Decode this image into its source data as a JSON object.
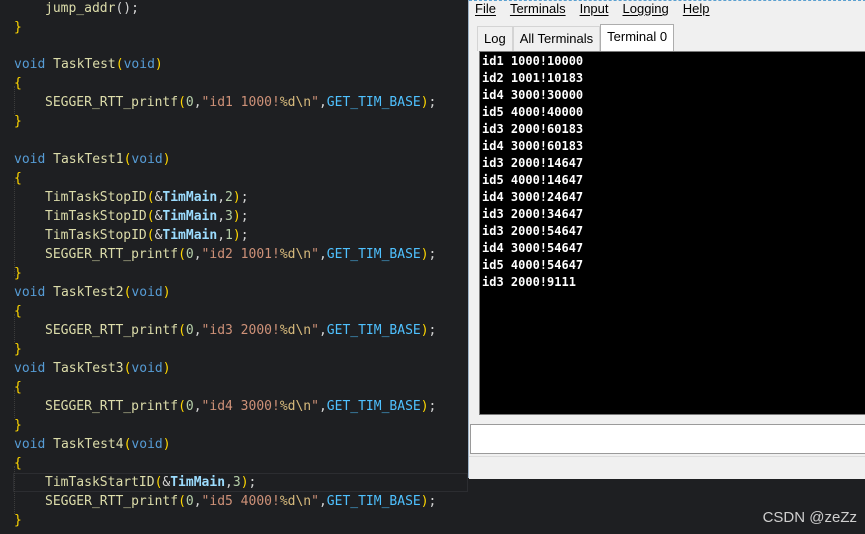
{
  "editor": {
    "jump": {
      "fn": "jump_addr",
      "rest": "();"
    },
    "brace_open": "{",
    "brace_close": "}",
    "void_kw": "void",
    "void_arg": "void",
    "funcs": {
      "t0": "TaskTest",
      "t1": "TaskTest1",
      "t2": "TaskTest2",
      "t3": "TaskTest3",
      "t4": "TaskTest4"
    },
    "printf": {
      "name": "SEGGER_RTT_printf",
      "zero": "0",
      "fmt_pre_id1": "\"id1 1000!",
      "fmt_pre_id2": "\"id2 1001!",
      "fmt_pre_id3": "\"id3 2000!",
      "fmt_pre_id4": "\"id4 3000!",
      "fmt_pre_id5": "\"id5 4000!",
      "fmt_spec": "%d",
      "fmt_esc": "\\n",
      "fmt_end": "\"",
      "macro": "GET_TIM_BASE",
      "end": ");"
    },
    "stop": {
      "name": "TimTaskStopID",
      "var": "TimMain",
      "args": [
        "2",
        "3",
        "1"
      ]
    },
    "start": {
      "name": "TimTaskStartID",
      "var": "TimMain",
      "arg": "3"
    }
  },
  "rtt": {
    "menu": [
      "File",
      "Terminals",
      "Input",
      "Logging",
      "Help"
    ],
    "tabs": [
      "Log",
      "All Terminals",
      "Terminal 0"
    ],
    "active_tab": "Terminal 0",
    "lines": [
      "id1 1000!10000",
      "id2 1001!10183",
      "id4 3000!30000",
      "id5 4000!40000",
      "id3 2000!60183",
      "id4 3000!60183",
      "id3 2000!14647",
      "id5 4000!14647",
      "id4 3000!24647",
      "id3 2000!34647",
      "id3 2000!54647",
      "id4 3000!54647",
      "id5 4000!54647",
      "id3 2000!9111"
    ]
  },
  "watermark": "CSDN @zeZz"
}
